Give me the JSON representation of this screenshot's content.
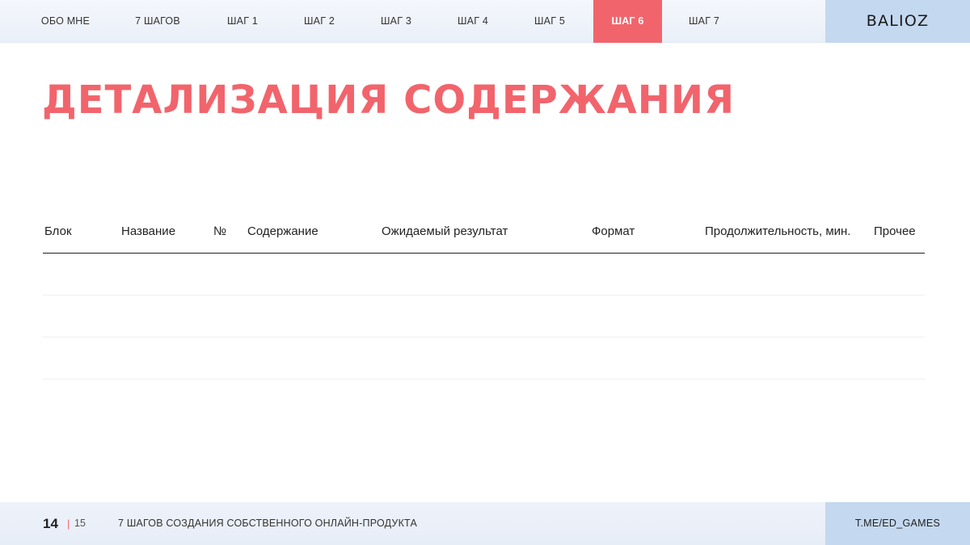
{
  "nav": {
    "items": [
      {
        "label": "ОБО МНЕ",
        "active": false
      },
      {
        "label": "7 ШАГОВ",
        "active": false
      },
      {
        "label": "ШАГ 1",
        "active": false
      },
      {
        "label": "ШАГ 2",
        "active": false
      },
      {
        "label": "ШАГ 3",
        "active": false
      },
      {
        "label": "ШАГ 4",
        "active": false
      },
      {
        "label": "ШАГ 5",
        "active": false
      },
      {
        "label": "ШАГ 6",
        "active": true
      },
      {
        "label": "ШАГ 7",
        "active": false
      }
    ],
    "logo": "BALIOZ"
  },
  "page": {
    "title": "ДЕТАЛИЗАЦИЯ СОДЕРЖАНИЯ"
  },
  "table": {
    "columns": [
      "Блок",
      "Название",
      "№",
      "Содержание",
      "Ожидаемый результат",
      "Формат",
      "Продолжительность, мин.",
      "Прочее"
    ],
    "rows": [
      [],
      [],
      []
    ]
  },
  "footer": {
    "page_number": "14",
    "separator": "|",
    "page_total": "15",
    "caption": "7 ШАГОВ СОЗДАНИЯ СОБСТВЕННОГО ОНЛАЙН-ПРОДУКТА",
    "link": "T.ME/ED_GAMES"
  },
  "colors": {
    "accent": "#f2646c",
    "nav_background": "#eef3fa",
    "logo_background": "#c4d8ef"
  }
}
